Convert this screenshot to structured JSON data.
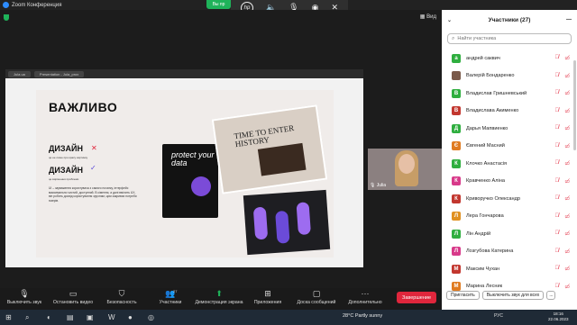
{
  "window": {
    "title": "Zoom Конференция",
    "view_label": "Вид",
    "green_pill": "Вы пр"
  },
  "share": {
    "tab_left": "Jula.ua",
    "tab_right": "Presentation - Jula_prox"
  },
  "slide": {
    "title": "ВАЖЛИВО",
    "line1": "ДИЗАЙН",
    "line1_sub": "це не лише про красу картинку",
    "line2": "ДИЗАЙН",
    "line2_sub": "це вирішення проблеми",
    "para": "UI – зауваження користувача з самого початку, інтерфейс максимально чистий, доступний. В сімення, а далі вмілить UX, він робить досвід користування зручним, цим закриває потреби юзерів.",
    "card1": "protect your data",
    "card2": "TIME TO ENTER HISTORY"
  },
  "camera": {
    "name": "Julia"
  },
  "toolbar": {
    "items": [
      {
        "label": "Выключить звук",
        "icon": "microphone-icon"
      },
      {
        "label": "Остановить видео",
        "icon": "video-icon"
      },
      {
        "label": "Безопасность",
        "icon": "shield-icon"
      },
      {
        "label": "Участники",
        "icon": "participants-icon",
        "count": "27"
      },
      {
        "label": "Демонстрация экрана",
        "icon": "share-screen-icon"
      },
      {
        "label": "Приложения",
        "icon": "apps-icon"
      },
      {
        "label": "Доска сообщений",
        "icon": "chat-icon"
      },
      {
        "label": "Дополнительно",
        "icon": "more-icon"
      }
    ],
    "end_label": "Завершение"
  },
  "participants": {
    "header": "Участники (27)",
    "search_placeholder": "Найти участника",
    "items": [
      {
        "initial": "а",
        "name": "андрей саквич",
        "color": "#2fae3f"
      },
      {
        "initial": "",
        "name": "Валерій Бондаренко",
        "color": "#7a5a4a"
      },
      {
        "initial": "В",
        "name": "Владислав Гришневський",
        "color": "#2fae3f"
      },
      {
        "initial": "В",
        "name": "Владислава Акименко",
        "color": "#c2372f"
      },
      {
        "initial": "Д",
        "name": "Дарья Мапвиенко",
        "color": "#2fae3f"
      },
      {
        "initial": "Є",
        "name": "Євгений Масний",
        "color": "#e07b20"
      },
      {
        "initial": "К",
        "name": "Клочко Анастасія",
        "color": "#2fae3f"
      },
      {
        "initial": "К",
        "name": "Кравченко Аліна",
        "color": "#d83a8a"
      },
      {
        "initial": "К",
        "name": "Криворучко Олександр",
        "color": "#c2372f"
      },
      {
        "initial": "Л",
        "name": "Лера Гончарова",
        "color": "#e09020"
      },
      {
        "initial": "Л",
        "name": "Лін Андрій",
        "color": "#2fae3f"
      },
      {
        "initial": "Л",
        "name": "Лозгубова Катерина",
        "color": "#d83a8a"
      },
      {
        "initial": "М",
        "name": "Максим Чухан",
        "color": "#c2372f"
      },
      {
        "initial": "М",
        "name": "Марина Лесник",
        "color": "#e07b20"
      }
    ],
    "invite_label": "Пригласить",
    "mute_all_label": "Выключить звук для всех",
    "more_label": "..."
  },
  "taskbar": {
    "weather": "28°C  Partly sunny",
    "lang": "РУС",
    "time": "18:16",
    "date": "22.06.2023"
  }
}
